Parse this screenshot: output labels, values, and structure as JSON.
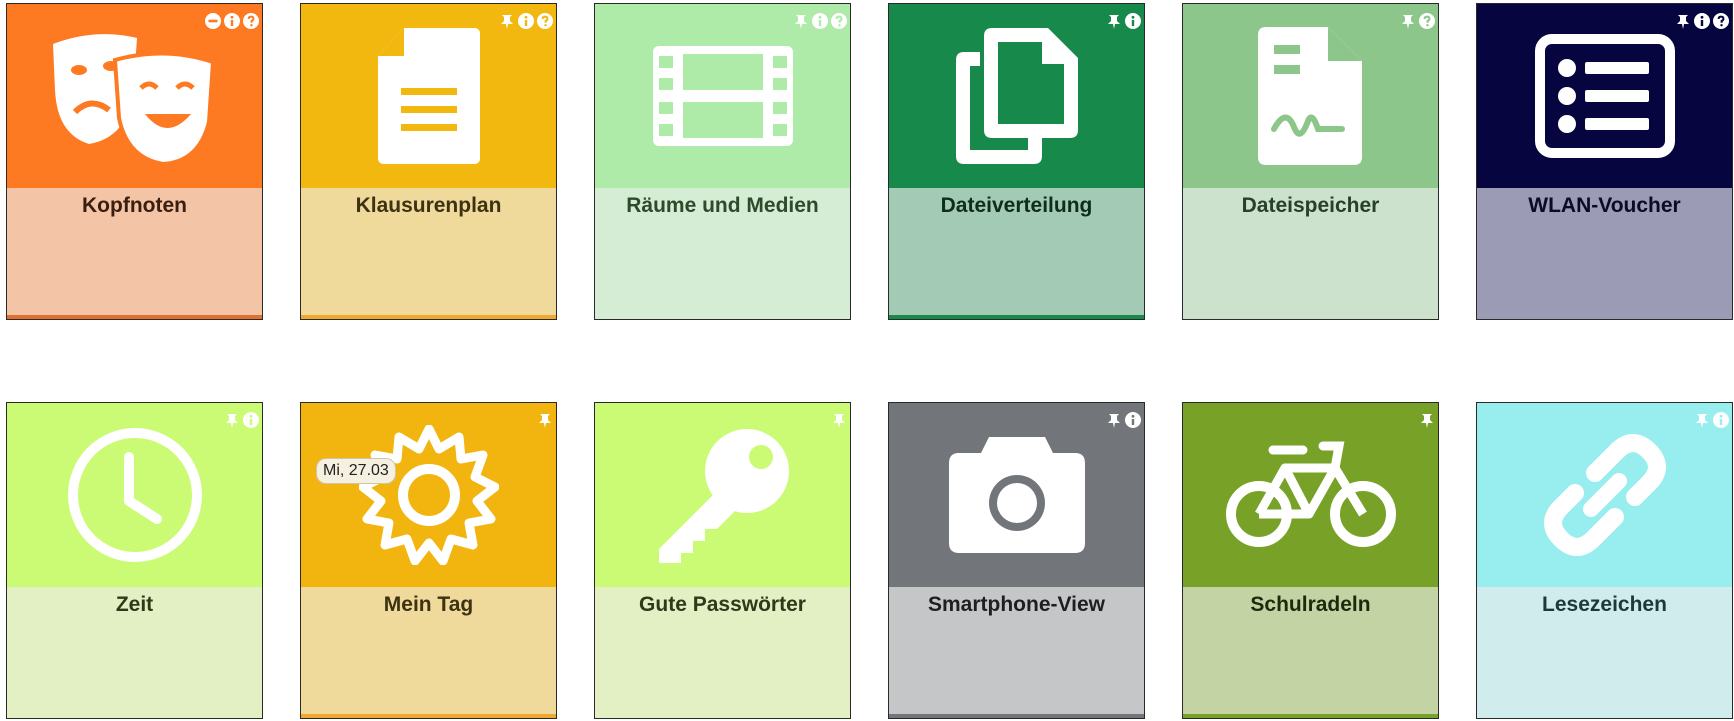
{
  "colors": {
    "kopfnoten": "#fe7a22",
    "klausurenplan": "#f2b810",
    "raeume": "#aeeba8",
    "dateiverteilung": "#17894a",
    "dateispeicher": "#8cc68b",
    "wlan": "#06053f",
    "zeit": "#cbfb74",
    "meintag": "#f2b50f",
    "passwoerter": "#cbfb74",
    "smartphone": "#727579",
    "schulradeln": "#77a227",
    "lesezeichen": "#98eeee"
  },
  "tiles": [
    {
      "label": "Kopfnoten",
      "icon": "theater-masks-icon",
      "controls": [
        "minus-icon",
        "info-icon",
        "help-icon"
      ]
    },
    {
      "label": "Klausurenplan",
      "icon": "document-icon",
      "controls": [
        "pin-icon",
        "info-icon",
        "help-icon"
      ]
    },
    {
      "label": "Räume und Medien",
      "icon": "film-icon",
      "controls": [
        "pin-icon",
        "info-icon",
        "help-icon"
      ]
    },
    {
      "label": "Dateiverteilung",
      "icon": "copy-files-icon",
      "controls": [
        "pin-icon",
        "info-icon"
      ]
    },
    {
      "label": "Dateispeicher",
      "icon": "file-signature-icon",
      "controls": [
        "pin-icon",
        "help-icon"
      ]
    },
    {
      "label": "WLAN-Voucher",
      "icon": "list-card-icon",
      "controls": [
        "pin-icon",
        "info-icon",
        "help-icon"
      ]
    },
    {
      "label": "Zeit",
      "icon": "clock-icon",
      "controls": [
        "pin-icon",
        "info-icon"
      ]
    },
    {
      "label": "Mein Tag",
      "icon": "sun-icon",
      "controls": [
        "pin-icon"
      ],
      "badge": "Mi, 27.03"
    },
    {
      "label": "Gute Passwörter",
      "icon": "key-icon",
      "controls": [
        "pin-icon"
      ]
    },
    {
      "label": "Smartphone-View",
      "icon": "camera-icon",
      "controls": [
        "pin-icon",
        "info-icon"
      ]
    },
    {
      "label": "Schulradeln",
      "icon": "bicycle-icon",
      "controls": [
        "pin-icon"
      ]
    },
    {
      "label": "Lesezeichen",
      "icon": "link-icon",
      "controls": [
        "pin-icon",
        "info-icon"
      ]
    }
  ]
}
